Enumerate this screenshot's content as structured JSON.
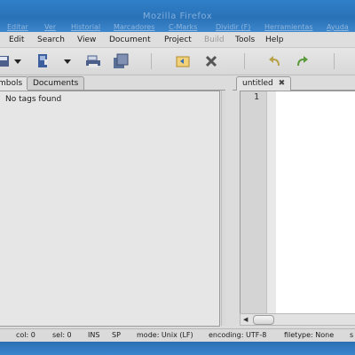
{
  "window": {
    "title": "Mozilla Firefox"
  },
  "background_menu": {
    "items": [
      "Editar",
      "Ver",
      "Historial",
      "Marcadores",
      "C-Marks",
      "Dividir (F)",
      "Herramientas",
      "Ayuda"
    ]
  },
  "menubar": {
    "items": [
      {
        "label": "Edit"
      },
      {
        "label": "Search"
      },
      {
        "label": "View"
      },
      {
        "label": "Document"
      },
      {
        "label": "Project"
      },
      {
        "label": "Build",
        "disabled": true
      },
      {
        "label": "Tools"
      },
      {
        "label": "Help"
      }
    ]
  },
  "toolbar": {
    "icons": [
      "save-icon",
      "dropdown-arrow-icon",
      "open-file-icon",
      "dropdown-arrow-icon",
      "print-icon",
      "save-all-icon",
      "revert-icon",
      "close-icon",
      "undo-icon",
      "redo-icon"
    ]
  },
  "sidebar": {
    "tabs": [
      {
        "label": "Symbols"
      },
      {
        "label": "Documents"
      }
    ],
    "empty_message": "No tags found"
  },
  "editor": {
    "tab_label": "untitled",
    "line_numbers": [
      "1"
    ]
  },
  "statusbar": {
    "col": "col: 0",
    "sel": "sel: 0",
    "ins": "INS",
    "sp": "SP",
    "mode": "mode: Unix (LF)",
    "encoding": "encoding: UTF-8",
    "filetype": "filetype: None",
    "scope": "s"
  },
  "colors": {
    "frame_blue": "#2f7fc8",
    "panel_gray": "#e6e6e6",
    "editor_bg": "#ffffff"
  }
}
